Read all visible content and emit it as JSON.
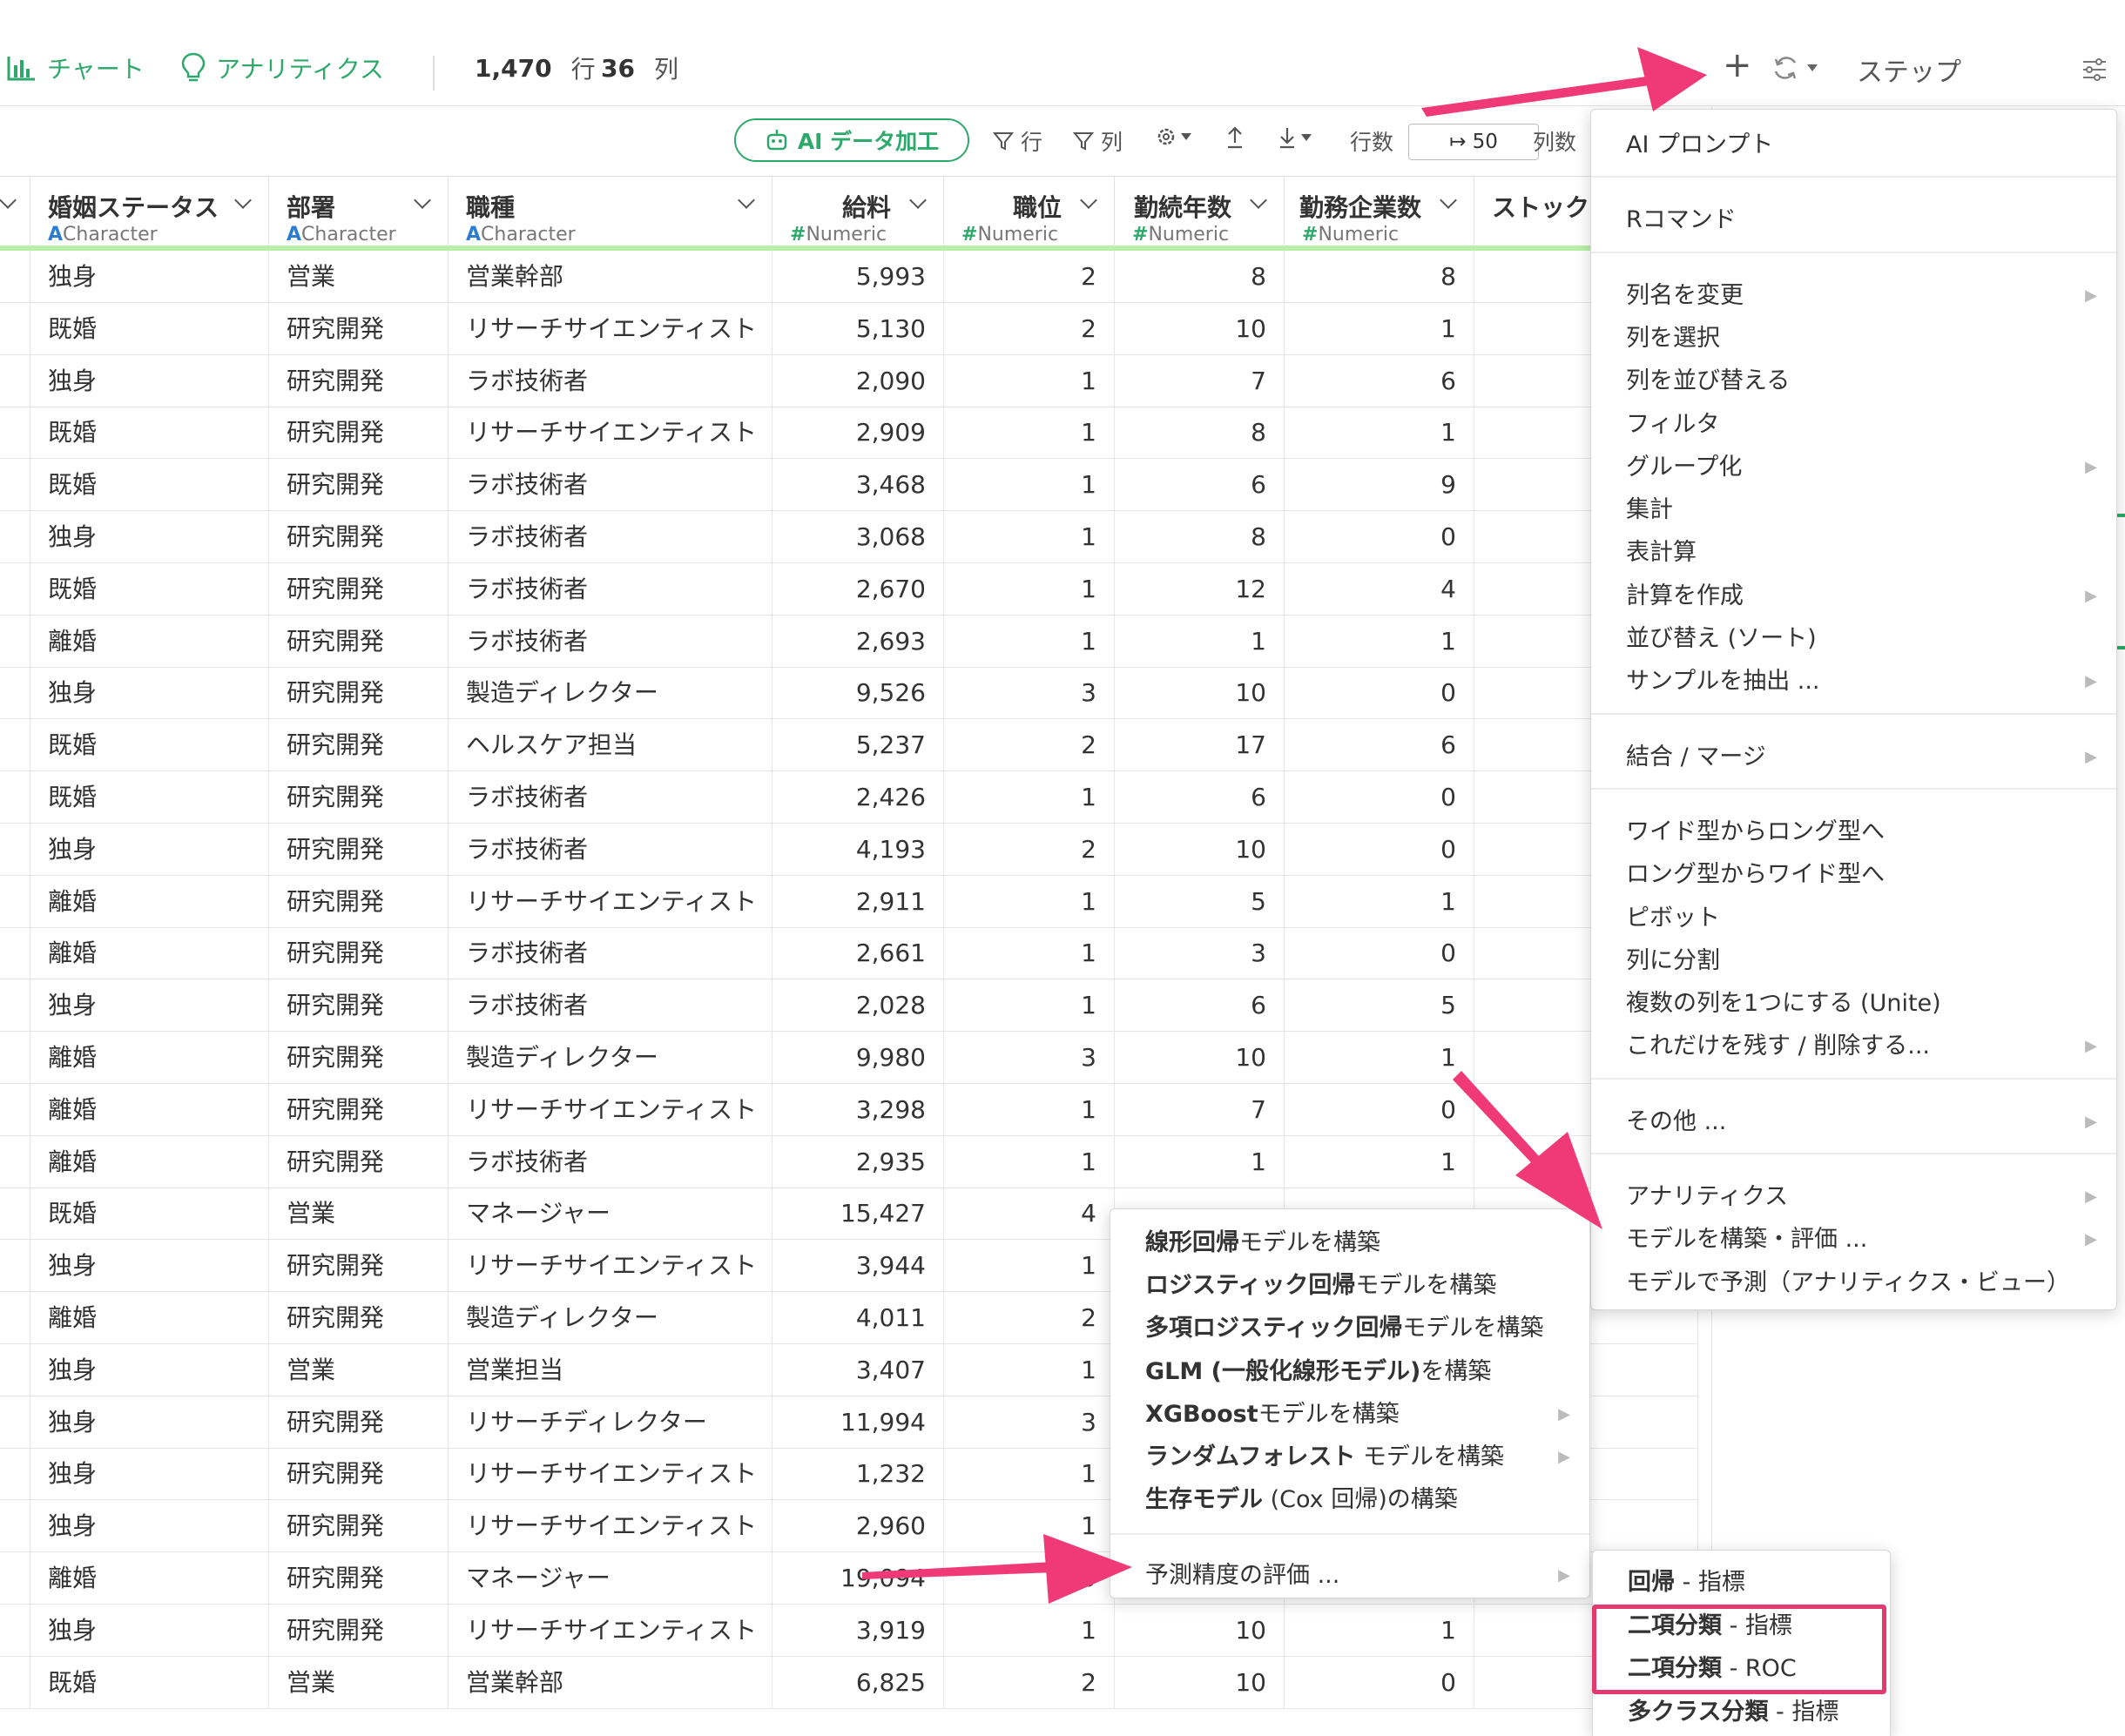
{
  "topbar": {
    "chart_tab": "チャート",
    "analytics_tab": "アナリティクス",
    "row_count": "1,470",
    "row_unit": "行",
    "col_count": "36",
    "col_unit": "列",
    "add_symbol": "+",
    "steps_label": "ステップ"
  },
  "toolbar": {
    "ai_button": "AI データ加工",
    "filter_rows": "行",
    "filter_cols": "列",
    "rows_label": "行数",
    "rows_value": "↦ 50",
    "cols_label": "列数"
  },
  "columns": [
    {
      "name": "婚姻ステータス",
      "type": "Character",
      "type_icon": "A"
    },
    {
      "name": "部署",
      "type": "Character",
      "type_icon": "A"
    },
    {
      "name": "職種",
      "type": "Character",
      "type_icon": "A"
    },
    {
      "name": "給料",
      "type": "Numeric",
      "type_icon": "#"
    },
    {
      "name": "職位",
      "type": "Numeric",
      "type_icon": "#"
    },
    {
      "name": "勤続年数",
      "type": "Numeric",
      "type_icon": "#"
    },
    {
      "name": "勤務企業数",
      "type": "Numeric",
      "type_icon": "#"
    },
    {
      "name": "ストック",
      "type": "",
      "type_icon": ""
    }
  ],
  "rows": [
    [
      "独身",
      "営業",
      "営業幹部",
      "5,993",
      "2",
      "8",
      "8"
    ],
    [
      "既婚",
      "研究開発",
      "リサーチサイエンティスト",
      "5,130",
      "2",
      "10",
      "1"
    ],
    [
      "独身",
      "研究開発",
      "ラボ技術者",
      "2,090",
      "1",
      "7",
      "6"
    ],
    [
      "既婚",
      "研究開発",
      "リサーチサイエンティスト",
      "2,909",
      "1",
      "8",
      "1"
    ],
    [
      "既婚",
      "研究開発",
      "ラボ技術者",
      "3,468",
      "1",
      "6",
      "9"
    ],
    [
      "独身",
      "研究開発",
      "ラボ技術者",
      "3,068",
      "1",
      "8",
      "0"
    ],
    [
      "既婚",
      "研究開発",
      "ラボ技術者",
      "2,670",
      "1",
      "12",
      "4"
    ],
    [
      "離婚",
      "研究開発",
      "ラボ技術者",
      "2,693",
      "1",
      "1",
      "1"
    ],
    [
      "独身",
      "研究開発",
      "製造ディレクター",
      "9,526",
      "3",
      "10",
      "0"
    ],
    [
      "既婚",
      "研究開発",
      "ヘルスケア担当",
      "5,237",
      "2",
      "17",
      "6"
    ],
    [
      "既婚",
      "研究開発",
      "ラボ技術者",
      "2,426",
      "1",
      "6",
      "0"
    ],
    [
      "独身",
      "研究開発",
      "ラボ技術者",
      "4,193",
      "2",
      "10",
      "0"
    ],
    [
      "離婚",
      "研究開発",
      "リサーチサイエンティスト",
      "2,911",
      "1",
      "5",
      "1"
    ],
    [
      "離婚",
      "研究開発",
      "ラボ技術者",
      "2,661",
      "1",
      "3",
      "0"
    ],
    [
      "独身",
      "研究開発",
      "ラボ技術者",
      "2,028",
      "1",
      "6",
      "5"
    ],
    [
      "離婚",
      "研究開発",
      "製造ディレクター",
      "9,980",
      "3",
      "10",
      "1"
    ],
    [
      "離婚",
      "研究開発",
      "リサーチサイエンティスト",
      "3,298",
      "1",
      "7",
      "0"
    ],
    [
      "離婚",
      "研究開発",
      "ラボ技術者",
      "2,935",
      "1",
      "1",
      "1"
    ],
    [
      "既婚",
      "営業",
      "マネージャー",
      "15,427",
      "4",
      "",
      ""
    ],
    [
      "独身",
      "研究開発",
      "リサーチサイエンティスト",
      "3,944",
      "1",
      "",
      ""
    ],
    [
      "離婚",
      "研究開発",
      "製造ディレクター",
      "4,011",
      "2",
      "",
      ""
    ],
    [
      "独身",
      "営業",
      "営業担当",
      "3,407",
      "1",
      "",
      ""
    ],
    [
      "独身",
      "研究開発",
      "リサーチディレクター",
      "11,994",
      "3",
      "",
      ""
    ],
    [
      "独身",
      "研究開発",
      "リサーチサイエンティスト",
      "1,232",
      "1",
      "",
      ""
    ],
    [
      "独身",
      "研究開発",
      "リサーチサイエンティスト",
      "2,960",
      "1",
      "",
      ""
    ],
    [
      "離婚",
      "研究開発",
      "マネージャー",
      "19,094",
      "5",
      "",
      ""
    ],
    [
      "独身",
      "研究開発",
      "リサーチサイエンティスト",
      "3,919",
      "1",
      "10",
      "1"
    ],
    [
      "既婚",
      "営業",
      "営業幹部",
      "6,825",
      "2",
      "10",
      "0"
    ]
  ],
  "main_menu": [
    {
      "label": "AI プロンプト",
      "sub": false
    },
    {
      "sep": true
    },
    {
      "label": "Rコマンド",
      "sub": false
    },
    {
      "sep": true
    },
    {
      "label": "列名を変更",
      "sub": true
    },
    {
      "label": "列を選択",
      "sub": false
    },
    {
      "label": "列を並び替える",
      "sub": false
    },
    {
      "label": "フィルタ",
      "sub": false
    },
    {
      "label": "グループ化",
      "sub": true
    },
    {
      "label": "集計",
      "sub": false
    },
    {
      "label": "表計算",
      "sub": false
    },
    {
      "label": "計算を作成",
      "sub": true
    },
    {
      "label": "並び替え (ソート)",
      "sub": false
    },
    {
      "label": "サンプルを抽出 ...",
      "sub": true
    },
    {
      "sep": true
    },
    {
      "label": "結合 / マージ",
      "sub": true
    },
    {
      "sep": true
    },
    {
      "label": "ワイド型からロング型へ",
      "sub": false
    },
    {
      "label": "ロング型からワイド型へ",
      "sub": false
    },
    {
      "label": "ピボット",
      "sub": false
    },
    {
      "label": "列に分割",
      "sub": false
    },
    {
      "label": "複数の列を1つにする (Unite)",
      "sub": false
    },
    {
      "label": "これだけを残す / 削除する...",
      "sub": true
    },
    {
      "sep": true
    },
    {
      "label": "その他 ...",
      "sub": true
    },
    {
      "sep": true
    },
    {
      "label": "アナリティクス",
      "sub": true
    },
    {
      "label": "モデルを構築・評価 ...",
      "sub": true
    },
    {
      "label": "モデルで予測（アナリティクス・ビュー）",
      "sub": false
    }
  ],
  "model_menu": [
    {
      "bold": "線形回帰",
      "rest": "モデルを構築",
      "sub": false
    },
    {
      "bold": "ロジスティック回帰",
      "rest": "モデルを構築",
      "sub": false
    },
    {
      "bold": "多項ロジスティック回帰",
      "rest": "モデルを構築",
      "sub": false
    },
    {
      "bold": "GLM (一般化線形モデル)",
      "rest": "を構築",
      "sub": false
    },
    {
      "bold": "XGBoost",
      "rest": "モデルを構築",
      "sub": true
    },
    {
      "bold": "ランダムフォレスト",
      "rest": " モデルを構築",
      "sub": true
    },
    {
      "bold": "生存モデル",
      "rest": " (Cox 回帰)の構築",
      "sub": false
    },
    {
      "sep": true
    },
    {
      "bold": "",
      "rest": "予測精度の評価 ...",
      "sub": true
    }
  ],
  "eval_menu": [
    {
      "bold": "回帰",
      "rest": " - 指標"
    },
    {
      "bold": "二項分類",
      "rest": " - 指標"
    },
    {
      "bold": "二項分類",
      "rest": " - ROC"
    },
    {
      "bold": "多クラス分類",
      "rest": " - 指標"
    }
  ],
  "colors": {
    "accent_green": "#2fa86b",
    "highlight_pink": "#e33a70",
    "type_blue": "#2b7dd1"
  }
}
